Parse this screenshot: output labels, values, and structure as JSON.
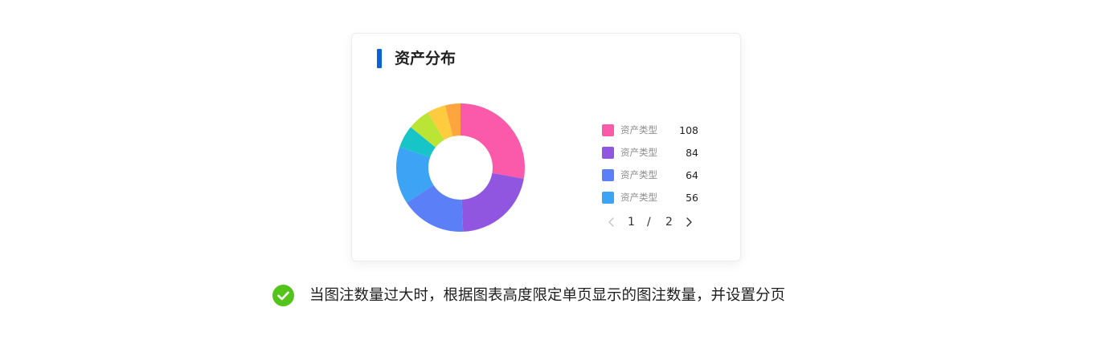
{
  "card": {
    "title": "资产分布"
  },
  "chart_data": {
    "type": "pie",
    "donut": true,
    "title": "资产分布",
    "slices": [
      {
        "label": "资产类型",
        "value": 108,
        "color": "#fa5aa9"
      },
      {
        "label": "资产类型",
        "value": 84,
        "color": "#9156e0"
      },
      {
        "label": "资产类型",
        "value": 64,
        "color": "#5b7ff7"
      },
      {
        "label": "资产类型",
        "value": 56,
        "color": "#3ca3f5"
      },
      {
        "value": 22,
        "color": "#17c5c8"
      },
      {
        "value": 22,
        "color": "#bbe535"
      },
      {
        "value": 18,
        "color": "#ffcc3f"
      },
      {
        "value": 15,
        "color": "#ffa53f"
      }
    ],
    "legend_position": "right",
    "legend_page": {
      "current": "1",
      "separator": "/",
      "total": "2"
    }
  },
  "legend": [
    {
      "label": "资产类型",
      "value": "108",
      "color": "#fa5aa9"
    },
    {
      "label": "资产类型",
      "value": "84",
      "color": "#9156e0"
    },
    {
      "label": "资产类型",
      "value": "64",
      "color": "#5b7ff7"
    },
    {
      "label": "资产类型",
      "value": "56",
      "color": "#3ca3f5"
    }
  ],
  "pager": {
    "current": "1",
    "separator": "/",
    "total": "2",
    "prev_icon": "chevron-left-icon",
    "next_icon": "chevron-right-icon"
  },
  "note": {
    "icon": "check-circle-icon",
    "icon_color": "#52c41a",
    "text": "当图注数量过大时，根据图表高度限定单页显示的图注数量，并设置分页"
  }
}
